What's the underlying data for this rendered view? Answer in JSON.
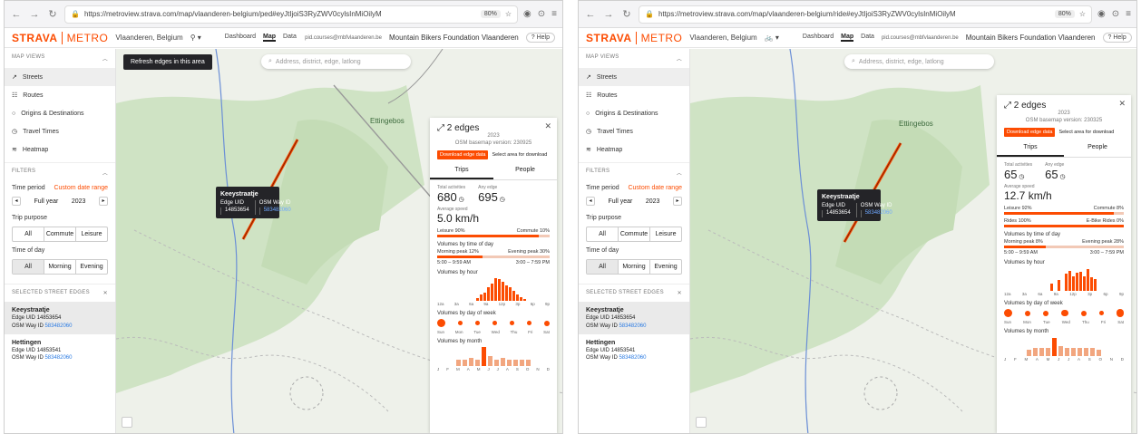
{
  "browser": {
    "url_left": "https://metroview.strava.com/map/vlaanderen-belgium/ped#eyJtIjoiS3RyZWV0cylsInMiOilyM",
    "url_right": "https://metroview.strava.com/map/vlaanderen-belgium/ride#eyJtIjoiS3RyZWV0cylsInMiOilyM",
    "zoom": "80%"
  },
  "header": {
    "logo": "STRAVA",
    "product": "METRO",
    "region": "Vlaanderen, Belgium",
    "tabs": [
      "Dashboard",
      "Map",
      "Data"
    ],
    "active_tab": "Map",
    "email": "pid.courses@mbfvlaanderen.be",
    "org": "Mountain Bikers Foundation Vlaanderen",
    "help": "Help"
  },
  "sidebar": {
    "map_views_title": "MAP VIEWS",
    "views": [
      "Streets",
      "Routes",
      "Origins & Destinations",
      "Travel Times",
      "Heatmap"
    ],
    "filters_title": "FILTERS",
    "time_period_label": "Time period",
    "custom_range": "Custom date range",
    "period": "Full year",
    "year": "2023",
    "trip_purpose_label": "Trip purpose",
    "trip_purpose": [
      "All",
      "Commute",
      "Leisure"
    ],
    "time_of_day_label": "Time of day",
    "time_of_day": [
      "All",
      "Morning",
      "Evening"
    ],
    "selected_title": "SELECTED STREET EDGES",
    "edges": [
      {
        "name": "Keeystraatje",
        "uid_label": "Edge UID",
        "uid": "14853654",
        "osm_label": "OSM Way ID",
        "osm": "583482060"
      },
      {
        "name": "Hettingen",
        "uid_label": "Edge UID",
        "uid": "14853541",
        "osm_label": "OSM Way ID",
        "osm": "583482060"
      }
    ]
  },
  "map": {
    "search_placeholder": "Address, district, edge, latlong",
    "refresh": "Refresh edges in this area",
    "place": "Ettingebos",
    "tooltip": {
      "name": "Keeystraatje",
      "uid_label": "Edge UID",
      "uid": "14853654",
      "osm_label": "OSM Way ID",
      "osm": "583482060"
    }
  },
  "detail_left": {
    "title": "2 edges",
    "year": "2023",
    "basemap": "OSM basemap version: 230925",
    "download": "Download edge data",
    "select_area": "Select area for download",
    "tabs": [
      "Trips",
      "People"
    ],
    "total_label": "Total activities",
    "total": "680",
    "any_label": "Any edge",
    "any": "695",
    "speed_label": "Average speed",
    "speed": "5.0 km/h",
    "split1_left": "Leisure 90%",
    "split1_right": "Commute 10%",
    "split1_pct": 90,
    "tod_title": "Volumes by time of day",
    "morning": "Morning peak 12%",
    "evening": "Evening peak 30%",
    "morning_time": "5:00 – 9:59 AM",
    "evening_time": "3:00 – 7:59 PM",
    "tod_pct": 40,
    "hour_title": "Volumes by hour",
    "hours": [
      0,
      0,
      0,
      0,
      0,
      0,
      0,
      10,
      25,
      35,
      55,
      70,
      95,
      90,
      80,
      65,
      55,
      40,
      25,
      15,
      8,
      0,
      0,
      0
    ],
    "hour_axis": [
      "12a",
      "3a",
      "6a",
      "9a",
      "12p",
      "3p",
      "6p",
      "9p"
    ],
    "dow_title": "Volumes by day of week",
    "dow": [
      100,
      40,
      40,
      40,
      40,
      40,
      60
    ],
    "dow_labels": [
      "Sun",
      "Mon",
      "Tue",
      "Wed",
      "Thu",
      "Fri",
      "Sat"
    ],
    "month_title": "Volumes by month",
    "months": [
      30,
      30,
      40,
      30,
      95,
      50,
      30,
      40,
      30,
      30,
      30,
      30
    ],
    "month_labels": [
      "J",
      "F",
      "M",
      "A",
      "M",
      "J",
      "J",
      "A",
      "S",
      "O",
      "N",
      "D"
    ]
  },
  "detail_right": {
    "title": "2 edges",
    "year": "2023",
    "basemap": "OSM basemap version: 230325",
    "download": "Download edge data",
    "select_area": "Select area for download",
    "tabs": [
      "Trips",
      "People"
    ],
    "total_label": "Total activities",
    "total": "65",
    "any_label": "Any edge",
    "any": "65",
    "speed_label": "Average speed",
    "speed": "12.7 km/h",
    "split1_left": "Leisure 92%",
    "split1_right": "Commute 8%",
    "split1_pct": 92,
    "split2_left": "Rides 100%",
    "split2_right": "E-Bike Rides 0%",
    "split2_pct": 100,
    "tod_title": "Volumes by time of day",
    "morning": "Morning peak 8%",
    "evening": "Evening peak 28%",
    "morning_time": "5:00 – 9:59 AM",
    "evening_time": "3:00 – 7:59 PM",
    "tod_pct": 35,
    "hour_title": "Volumes by hour",
    "hours": [
      0,
      0,
      0,
      0,
      0,
      0,
      0,
      0,
      30,
      0,
      45,
      0,
      70,
      85,
      60,
      75,
      80,
      60,
      90,
      55,
      50,
      0,
      0,
      0
    ],
    "hour_axis": [
      "12a",
      "3a",
      "6a",
      "9a",
      "12p",
      "3p",
      "6p",
      "9p"
    ],
    "dow_title": "Volumes by day of week",
    "dow": [
      100,
      60,
      60,
      80,
      60,
      40,
      90
    ],
    "dow_labels": [
      "Sun",
      "Mon",
      "Tue",
      "Wed",
      "Thu",
      "Fri",
      "Sat"
    ],
    "month_title": "Volumes by month",
    "months": [
      30,
      40,
      40,
      40,
      90,
      50,
      40,
      40,
      40,
      40,
      40,
      30
    ],
    "month_labels": [
      "J",
      "F",
      "M",
      "A",
      "M",
      "J",
      "J",
      "A",
      "S",
      "O",
      "N",
      "D"
    ]
  }
}
